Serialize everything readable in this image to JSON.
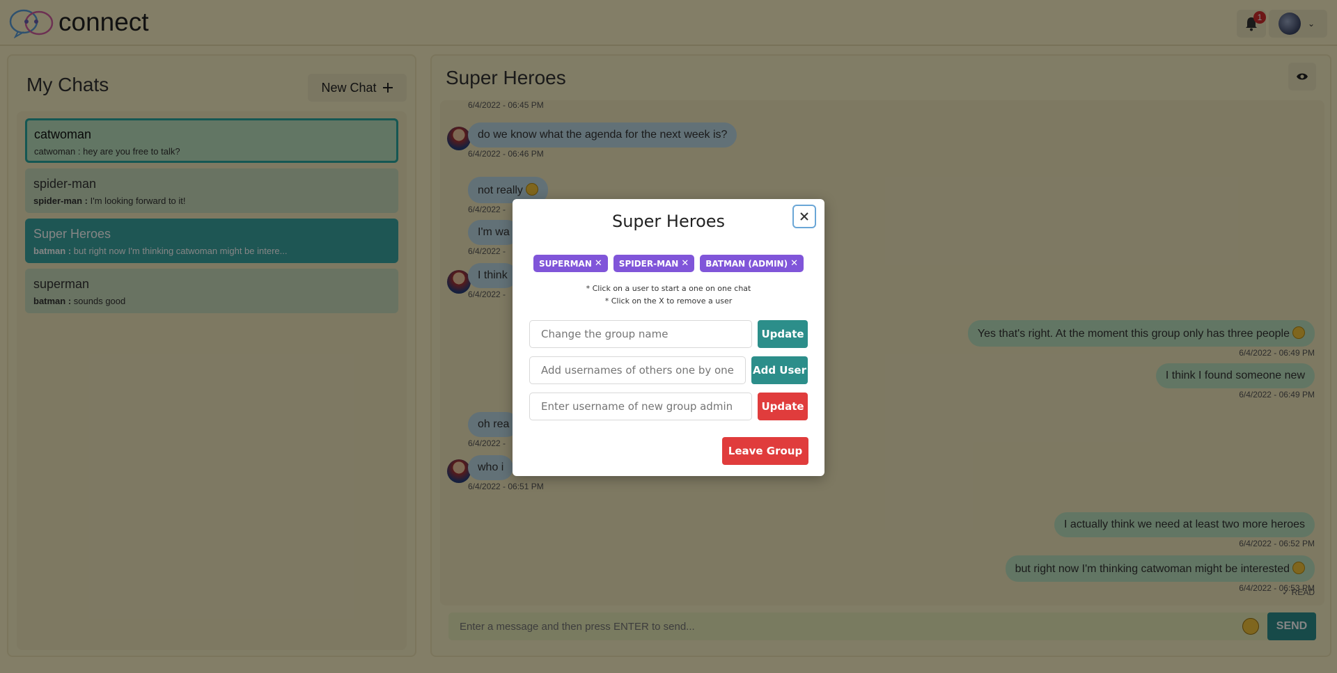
{
  "app": {
    "name": "connect",
    "notification_count": "1"
  },
  "sidebar": {
    "title": "My Chats",
    "new_chat_label": "New Chat",
    "chats": [
      {
        "name": "catwoman",
        "sender": "catwoman :",
        "preview": "hey are you free to talk?"
      },
      {
        "name": "spider-man",
        "sender": "spider-man :",
        "preview": "I'm looking forward to it!"
      },
      {
        "name": "Super Heroes",
        "sender": "batman :",
        "preview": "but right now I'm thinking catwoman might be intere..."
      },
      {
        "name": "superman",
        "sender": "batman :",
        "preview": "sounds good"
      }
    ]
  },
  "chat": {
    "title": "Super Heroes",
    "messages": [
      {
        "text": "6/4/2022 - 06:45 PM"
      },
      {
        "text": "do we know what the agenda for the next week is?",
        "time": "6/4/2022 - 06:46 PM"
      },
      {
        "text": "not really",
        "time": "6/4/2022 -"
      },
      {
        "text": "I'm wa",
        "time": "6/4/2022 -"
      },
      {
        "text": "I think",
        "time": "6/4/2022 -"
      },
      {
        "text": "Yes that's right. At the moment this group only has three people",
        "time": "6/4/2022 - 06:49 PM"
      },
      {
        "text": "I think I found someone new",
        "time": "6/4/2022 - 06:49 PM"
      },
      {
        "text": "oh rea",
        "time": "6/4/2022 -"
      },
      {
        "text": "who i",
        "time": "6/4/2022 - 06:51 PM"
      },
      {
        "text": "I actually think we need at least two more heroes",
        "time": "6/4/2022 - 06:52 PM"
      },
      {
        "text": "but right now I'm thinking catwoman might be interested",
        "time": "6/4/2022 - 06:53 PM"
      }
    ],
    "read_label": "READ",
    "composer_placeholder": "Enter a message and then press ENTER to send...",
    "send_label": "SEND"
  },
  "modal": {
    "title": "Super Heroes",
    "members": [
      "SUPERMAN",
      "SPIDER-MAN",
      "BATMAN (ADMIN)"
    ],
    "hint_line1": "* Click on a user to start a one on one chat",
    "hint_line2": "* Click on the X to remove a user",
    "rename_placeholder": "Change the group name",
    "rename_button": "Update",
    "add_user_placeholder": "Add usernames of others one by one",
    "add_user_button": "Add User",
    "admin_placeholder": "Enter username of new group admin",
    "admin_button": "Update",
    "leave_button": "Leave Group"
  },
  "colors": {
    "background": "#fbf2c6",
    "teal": "#2c8e8a",
    "tag_purple": "#8055d9",
    "danger_red": "#e03c3c",
    "incoming_bubble": "#bcd9e5",
    "outgoing_bubble": "#bde3c0"
  }
}
